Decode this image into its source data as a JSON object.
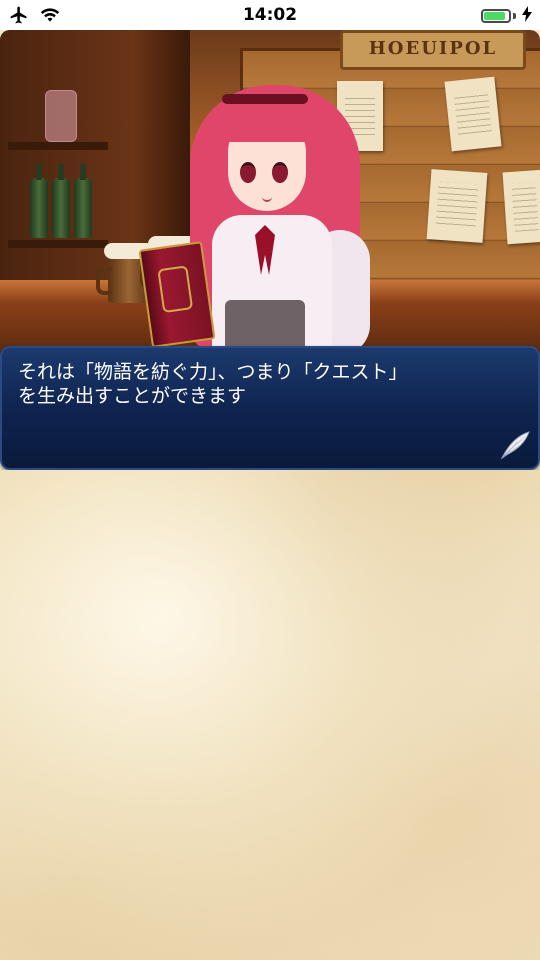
{
  "status_bar": {
    "time": "14:02",
    "airplane_icon": "airplane-icon",
    "wifi_icon": "wifi-icon",
    "battery_icon": "battery-icon",
    "charging_icon": "charging-bolt-icon",
    "battery_level": 0.9,
    "battery_color": "#4cd964"
  },
  "scene": {
    "sign_text": "HOEUIPOL",
    "description_icon": "tavern-background"
  },
  "dialog": {
    "text": "それは「物語を紡ぐ力」、つまり「クエスト」\nを生み出すことができます",
    "advance_icon": "feather-quill-icon",
    "background_color": "#0f2450"
  }
}
